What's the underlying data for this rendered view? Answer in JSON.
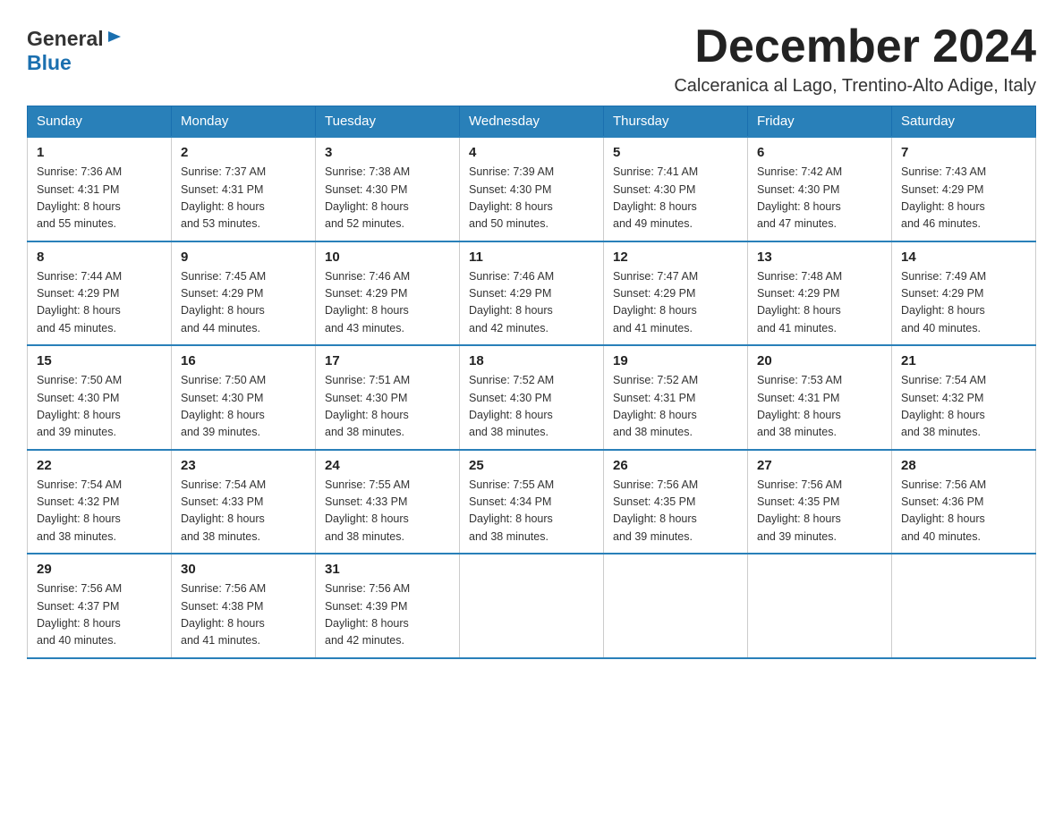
{
  "header": {
    "logo_general": "General",
    "logo_blue": "Blue",
    "month_title": "December 2024",
    "location": "Calceranica al Lago, Trentino-Alto Adige, Italy"
  },
  "days_of_week": [
    "Sunday",
    "Monday",
    "Tuesday",
    "Wednesday",
    "Thursday",
    "Friday",
    "Saturday"
  ],
  "weeks": [
    [
      {
        "num": "1",
        "sunrise": "7:36 AM",
        "sunset": "4:31 PM",
        "daylight": "8 hours and 55 minutes."
      },
      {
        "num": "2",
        "sunrise": "7:37 AM",
        "sunset": "4:31 PM",
        "daylight": "8 hours and 53 minutes."
      },
      {
        "num": "3",
        "sunrise": "7:38 AM",
        "sunset": "4:30 PM",
        "daylight": "8 hours and 52 minutes."
      },
      {
        "num": "4",
        "sunrise": "7:39 AM",
        "sunset": "4:30 PM",
        "daylight": "8 hours and 50 minutes."
      },
      {
        "num": "5",
        "sunrise": "7:41 AM",
        "sunset": "4:30 PM",
        "daylight": "8 hours and 49 minutes."
      },
      {
        "num": "6",
        "sunrise": "7:42 AM",
        "sunset": "4:30 PM",
        "daylight": "8 hours and 47 minutes."
      },
      {
        "num": "7",
        "sunrise": "7:43 AM",
        "sunset": "4:29 PM",
        "daylight": "8 hours and 46 minutes."
      }
    ],
    [
      {
        "num": "8",
        "sunrise": "7:44 AM",
        "sunset": "4:29 PM",
        "daylight": "8 hours and 45 minutes."
      },
      {
        "num": "9",
        "sunrise": "7:45 AM",
        "sunset": "4:29 PM",
        "daylight": "8 hours and 44 minutes."
      },
      {
        "num": "10",
        "sunrise": "7:46 AM",
        "sunset": "4:29 PM",
        "daylight": "8 hours and 43 minutes."
      },
      {
        "num": "11",
        "sunrise": "7:46 AM",
        "sunset": "4:29 PM",
        "daylight": "8 hours and 42 minutes."
      },
      {
        "num": "12",
        "sunrise": "7:47 AM",
        "sunset": "4:29 PM",
        "daylight": "8 hours and 41 minutes."
      },
      {
        "num": "13",
        "sunrise": "7:48 AM",
        "sunset": "4:29 PM",
        "daylight": "8 hours and 41 minutes."
      },
      {
        "num": "14",
        "sunrise": "7:49 AM",
        "sunset": "4:29 PM",
        "daylight": "8 hours and 40 minutes."
      }
    ],
    [
      {
        "num": "15",
        "sunrise": "7:50 AM",
        "sunset": "4:30 PM",
        "daylight": "8 hours and 39 minutes."
      },
      {
        "num": "16",
        "sunrise": "7:50 AM",
        "sunset": "4:30 PM",
        "daylight": "8 hours and 39 minutes."
      },
      {
        "num": "17",
        "sunrise": "7:51 AM",
        "sunset": "4:30 PM",
        "daylight": "8 hours and 38 minutes."
      },
      {
        "num": "18",
        "sunrise": "7:52 AM",
        "sunset": "4:30 PM",
        "daylight": "8 hours and 38 minutes."
      },
      {
        "num": "19",
        "sunrise": "7:52 AM",
        "sunset": "4:31 PM",
        "daylight": "8 hours and 38 minutes."
      },
      {
        "num": "20",
        "sunrise": "7:53 AM",
        "sunset": "4:31 PM",
        "daylight": "8 hours and 38 minutes."
      },
      {
        "num": "21",
        "sunrise": "7:54 AM",
        "sunset": "4:32 PM",
        "daylight": "8 hours and 38 minutes."
      }
    ],
    [
      {
        "num": "22",
        "sunrise": "7:54 AM",
        "sunset": "4:32 PM",
        "daylight": "8 hours and 38 minutes."
      },
      {
        "num": "23",
        "sunrise": "7:54 AM",
        "sunset": "4:33 PM",
        "daylight": "8 hours and 38 minutes."
      },
      {
        "num": "24",
        "sunrise": "7:55 AM",
        "sunset": "4:33 PM",
        "daylight": "8 hours and 38 minutes."
      },
      {
        "num": "25",
        "sunrise": "7:55 AM",
        "sunset": "4:34 PM",
        "daylight": "8 hours and 38 minutes."
      },
      {
        "num": "26",
        "sunrise": "7:56 AM",
        "sunset": "4:35 PM",
        "daylight": "8 hours and 39 minutes."
      },
      {
        "num": "27",
        "sunrise": "7:56 AM",
        "sunset": "4:35 PM",
        "daylight": "8 hours and 39 minutes."
      },
      {
        "num": "28",
        "sunrise": "7:56 AM",
        "sunset": "4:36 PM",
        "daylight": "8 hours and 40 minutes."
      }
    ],
    [
      {
        "num": "29",
        "sunrise": "7:56 AM",
        "sunset": "4:37 PM",
        "daylight": "8 hours and 40 minutes."
      },
      {
        "num": "30",
        "sunrise": "7:56 AM",
        "sunset": "4:38 PM",
        "daylight": "8 hours and 41 minutes."
      },
      {
        "num": "31",
        "sunrise": "7:56 AM",
        "sunset": "4:39 PM",
        "daylight": "8 hours and 42 minutes."
      },
      null,
      null,
      null,
      null
    ]
  ],
  "labels": {
    "sunrise_prefix": "Sunrise: ",
    "sunset_prefix": "Sunset: ",
    "daylight_prefix": "Daylight: "
  }
}
